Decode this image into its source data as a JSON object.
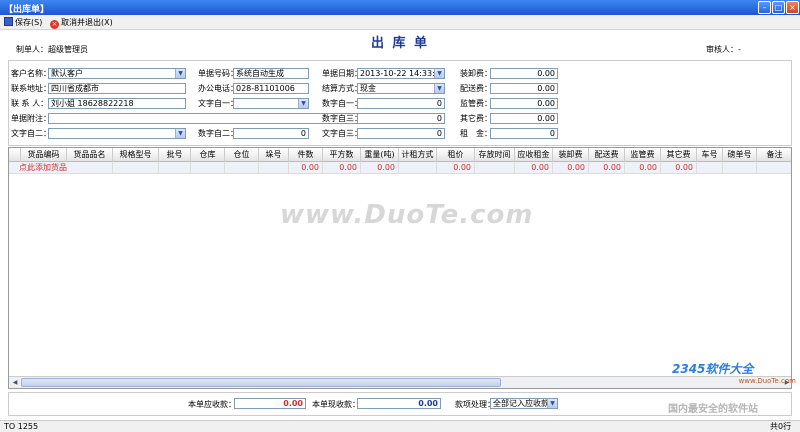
{
  "window": {
    "title": "【出库单】"
  },
  "toolbar": {
    "save": "保存(S)",
    "cancel": "取消并退出(X)"
  },
  "header": {
    "title": "出 库 单",
    "maker": "制单人：超级管理员",
    "auditor": "审核人：-"
  },
  "form": {
    "customer_label": "客户名称：",
    "customer_value": "默认客户",
    "address_label": "联系地址：",
    "address_value": "四川省成都市",
    "contact_label": "联 系 人：",
    "contact_value": "刘小姐 18628822218",
    "note_label": "单据附注：",
    "note_value": "",
    "text2_label": "文字自二：",
    "text2_value": "",
    "docno_label": "单据号码：",
    "docno_value": "系统自动生成",
    "phone_label": "办公电话：",
    "phone_value": "028-81101006",
    "text1_label": "文字自一：",
    "text1_value": "",
    "num2_label": "数字自二：",
    "num2_value": "0",
    "date_label": "单据日期：",
    "date_value": "2013-10-22 14:33:26",
    "settle_label": "结算方式：",
    "settle_value": "现金",
    "digit1_label": "数字自一：",
    "digit1_value": "0",
    "digit3_label": "数字自三：",
    "digit3_value": "0",
    "text3_label": "文字自三：",
    "text3_value": "0",
    "unload_label": "装卸费：",
    "unload_value": "0.00",
    "delivery_label": "配送费：",
    "delivery_value": "0.00",
    "supervise_label": "监管费：",
    "supervise_value": "0.00",
    "other_label": "其它费：",
    "other_value": "0.00",
    "rent_label": "租　金：",
    "rent_value": "0"
  },
  "grid": {
    "columns": [
      "货品编码",
      "货品品名",
      "规格型号",
      "批号",
      "仓库",
      "仓位",
      "垛号",
      "件数",
      "平方数",
      "重量(吨)",
      "计租方式",
      "租价",
      "存放时间",
      "应收租金",
      "装卸费",
      "配送费",
      "监管费",
      "其它费",
      "车号",
      "磅单号",
      "备注"
    ],
    "row": {
      "add_link": "点此添加货品",
      "qty": "0.00",
      "area": "0.00",
      "weight": "0.00",
      "price": "0.00",
      "rent": "0.00",
      "unload": "0.00",
      "delivery": "0.00",
      "supervise": "0.00",
      "other": "0.00"
    }
  },
  "watermark": {
    "text": "www.DuoTe.com",
    "brand": "2345软件大全",
    "brand_url": "www.DuoTe.com",
    "slogan": "国内最安全的软件站"
  },
  "footer": {
    "receivable_label": "本单应收款：",
    "receivable_value": "0.00",
    "received_label": "本单现收款：",
    "received_value": "0.00",
    "handling_label": "款项处理：",
    "handling_value": "全部记入应收款"
  },
  "status": {
    "left": "TO 1255",
    "right": "共0行"
  },
  "colors": {
    "accent": "#1b3a9a",
    "red": "#d0302a"
  }
}
